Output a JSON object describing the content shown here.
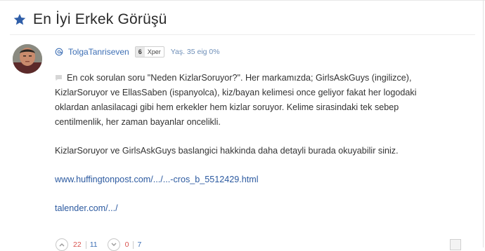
{
  "header": {
    "title": "En İyi Erkek Görüşü",
    "star_color": "#2f5ea8"
  },
  "post": {
    "author": {
      "username": "TolgaTanriseven",
      "level": "6",
      "rank": "Xper",
      "age_text": "Yaş. 35 eig 0%"
    },
    "paragraphs": [
      "En cok sorulan soru \"Neden KizlarSoruyor?\". Her markamızda; GirlsAskGuys (ingilizce), KizlarSoruyor ve EllasSaben (ispanyolca), kiz/bayan kelimesi once geliyor fakat her logodaki oklardan anlasilacagi gibi hem erkekler hem kizlar soruyor. Kelime sirasindaki tek sebep centilmenlik, her zaman bayanlar oncelikli.",
      "KizlarSoruyor ve GirlsAskGuys baslangici hakkinda daha detayli burada okuyabilir siniz."
    ],
    "links": [
      "www.huffingtonpost.com/.../...-cros_b_5512429.html",
      "talender.com/.../"
    ],
    "votes": {
      "up_a": "22",
      "up_b": "11",
      "down_a": "0",
      "down_b": "7"
    }
  },
  "colors": {
    "link": "#2c5aa0",
    "username": "#3d6fb5",
    "vote_red": "#d9534f"
  }
}
